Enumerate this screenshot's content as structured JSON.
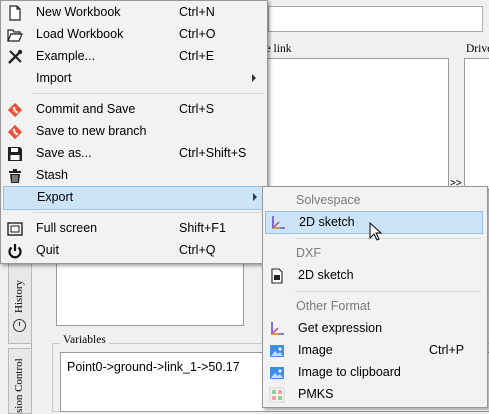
{
  "background": {
    "panel_labels": [
      "ase link",
      "Drive"
    ],
    "arrows": ">>",
    "side_tabs": [
      "History",
      "sion Control"
    ],
    "variables": {
      "label": "Variables",
      "value": "Point0->ground->link_1->50.17"
    }
  },
  "main_menu": {
    "items": [
      {
        "label": "New Workbook",
        "shortcut": "Ctrl+N",
        "icon": "new-file-icon"
      },
      {
        "label": "Load Workbook",
        "shortcut": "Ctrl+O",
        "icon": "folder-open-icon"
      },
      {
        "label": "Example...",
        "shortcut": "Ctrl+E",
        "icon": "tools-icon"
      },
      {
        "label": "Import",
        "shortcut": "",
        "icon": "",
        "submenu": true
      },
      {
        "label": "Commit and Save",
        "shortcut": "Ctrl+S",
        "icon": "git-icon"
      },
      {
        "label": "Save to new branch",
        "shortcut": "",
        "icon": "git-icon"
      },
      {
        "label": "Save as...",
        "shortcut": "Ctrl+Shift+S",
        "icon": "floppy-disk-icon"
      },
      {
        "label": "Stash",
        "shortcut": "",
        "icon": "trash-icon"
      },
      {
        "label": "Export",
        "shortcut": "",
        "icon": "",
        "submenu": true,
        "highlighted": true
      },
      {
        "label": "Full screen",
        "shortcut": "Shift+F1",
        "icon": "fullscreen-icon"
      },
      {
        "label": "Quit",
        "shortcut": "Ctrl+Q",
        "icon": "power-icon"
      }
    ]
  },
  "export_menu": {
    "sections": [
      "Solvespace",
      "DXF",
      "Other Format"
    ],
    "items": [
      {
        "label": "2D sketch",
        "shortcut": "",
        "icon": "sketch-axes-icon",
        "highlighted": true
      },
      {
        "label": "2D sketch",
        "shortcut": "",
        "icon": "dxf-document-icon"
      },
      {
        "label": "Get expression",
        "shortcut": "",
        "icon": "sketch-axes-icon"
      },
      {
        "label": "Image",
        "shortcut": "Ctrl+P",
        "icon": "image-icon"
      },
      {
        "label": "Image to clipboard",
        "shortcut": "",
        "icon": "image-icon"
      },
      {
        "label": "PMKS",
        "shortcut": "",
        "icon": "pmks-icon"
      }
    ]
  },
  "colors": {
    "highlight": "#cce4f7",
    "highlight_border": "#96c2ea",
    "git": "#e8503a",
    "image_blue": "#3d8ee6"
  }
}
